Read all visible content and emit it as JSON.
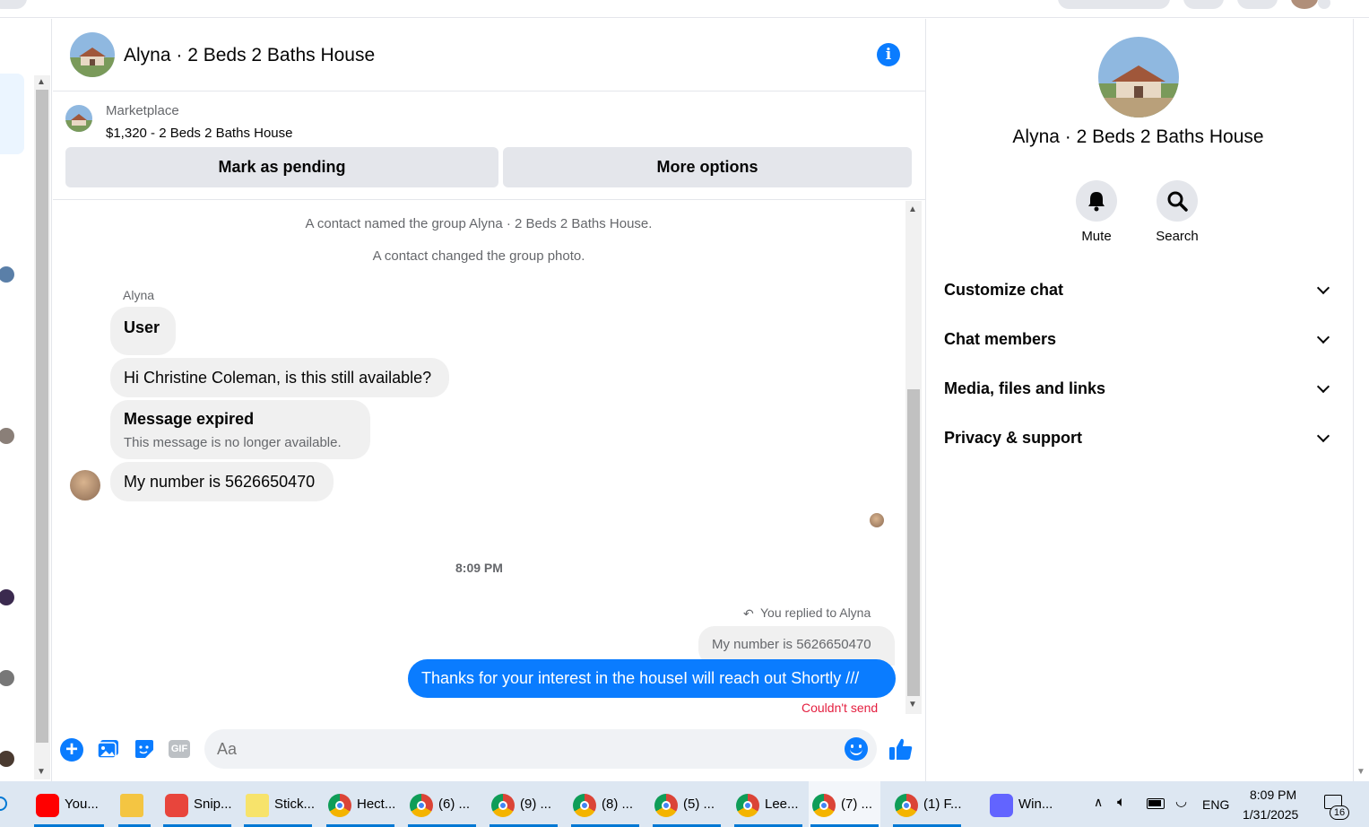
{
  "header": {
    "title": "Alyna · 2 Beds 2 Baths House"
  },
  "marketplace": {
    "label": "Marketplace",
    "listing": "$1,320 - 2 Beds 2 Baths House",
    "pending_button": "Mark as pending",
    "more_button": "More options"
  },
  "messages": {
    "system_1": "A contact named the group Alyna · 2 Beds 2 Baths House.",
    "system_2": "A contact changed the group photo.",
    "sender": "Alyna",
    "m1": "User",
    "m2": "Hi Christine Coleman, is this still available?",
    "expired_title": "Message expired",
    "expired_sub": "This message is no longer available.",
    "m3": "My number is 5626650470",
    "timestamp": "8:09 PM",
    "replied_to": "You replied to Alyna",
    "quoted": "My number is 5626650470",
    "outgoing": "Thanks for your interest in the houseI will reach out Shortly ///",
    "error": "Couldn't send"
  },
  "composer": {
    "placeholder": "Aa",
    "gif_label": "GIF"
  },
  "right_panel": {
    "title": "Alyna · 2 Beds 2 Baths House",
    "mute": "Mute",
    "search": "Search",
    "sections": [
      "Customize chat",
      "Chat members",
      "Media, files and links",
      "Privacy & support"
    ]
  },
  "taskbar": {
    "items": [
      {
        "label": "You...",
        "icon": "youtube-icon",
        "color": "#ff0000"
      },
      {
        "label": "",
        "icon": "file-explorer-icon",
        "color": "#f4c542"
      },
      {
        "label": "Snip...",
        "icon": "snipping-tool-icon",
        "color": "#e8453c"
      },
      {
        "label": "Stick...",
        "icon": "sticky-notes-icon",
        "color": "#f7e36b"
      },
      {
        "label": "Hect...",
        "icon": "chrome-icon",
        "color": "#db4437"
      },
      {
        "label": "(6) ...",
        "icon": "chrome-icon",
        "color": "#db4437"
      },
      {
        "label": "(9) ...",
        "icon": "chrome-icon",
        "color": "#db4437"
      },
      {
        "label": "(8) ...",
        "icon": "chrome-icon",
        "color": "#db4437"
      },
      {
        "label": "(5) ...",
        "icon": "chrome-icon",
        "color": "#db4437"
      },
      {
        "label": "Lee...",
        "icon": "chrome-icon",
        "color": "#db4437"
      },
      {
        "label": "(7) ...",
        "icon": "chrome-icon",
        "color": "#db4437"
      },
      {
        "label": "(1) F...",
        "icon": "chrome-icon",
        "color": "#db4437"
      },
      {
        "label": "Win...",
        "icon": "zoom-icon",
        "color": "#6264ff"
      }
    ],
    "language": "ENG",
    "clock_time": "8:09 PM",
    "clock_date": "1/31/2025",
    "notification_count": "16"
  },
  "colors": {
    "accent": "#0a7cff",
    "error": "#e41e3f",
    "bubble_in": "#f0f0f0"
  }
}
